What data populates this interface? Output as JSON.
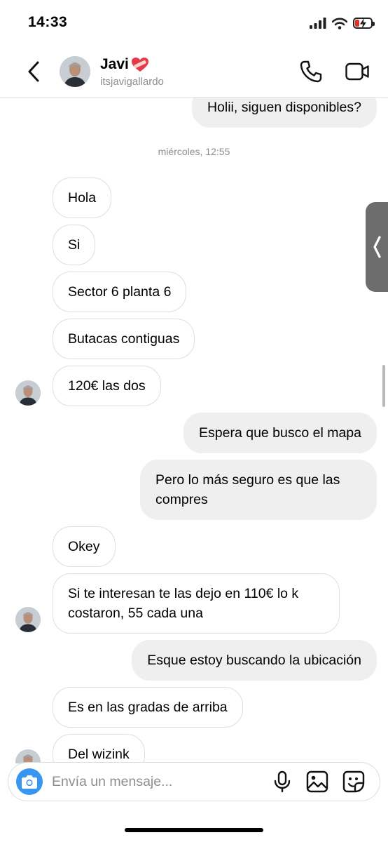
{
  "status_bar": {
    "time": "14:33",
    "battery_level": 0.25,
    "battery_color": "#e0302a"
  },
  "header": {
    "name": "Javi",
    "name_emoji": "heart-bandage-icon",
    "handle": "itsjavigallardo",
    "back_icon": "chevron-left-icon",
    "call_icon": "phone-icon",
    "video_icon": "video-camera-icon"
  },
  "messages": [
    {
      "from": "me",
      "text": "Holii, siguen disponibles?"
    },
    {
      "type": "timestamp",
      "text": "miércoles, 12:55"
    },
    {
      "from": "them",
      "text": "Hola"
    },
    {
      "from": "them",
      "text": "Si"
    },
    {
      "from": "them",
      "text": "Sector 6 planta 6"
    },
    {
      "from": "them",
      "text": "Butacas contiguas"
    },
    {
      "from": "them",
      "text": "120€ las dos"
    },
    {
      "from": "me",
      "text": "Espera que busco el mapa"
    },
    {
      "from": "me",
      "text": "Pero lo más seguro es que las compres"
    },
    {
      "from": "them",
      "text": "Okey"
    },
    {
      "from": "them",
      "text": "Si te interesan te las dejo en 110€ lo k costaron, 55 cada una"
    },
    {
      "from": "me",
      "text": "Esque estoy buscando la ubicación"
    },
    {
      "from": "them",
      "text": "Es en las gradas de arriba"
    },
    {
      "from": "them",
      "text": "Del wizink"
    }
  ],
  "composer": {
    "placeholder": "Envía un mensaje...",
    "camera_icon": "camera-icon",
    "mic_icon": "microphone-icon",
    "gallery_icon": "image-icon",
    "sticker_icon": "sticker-icon"
  },
  "colors": {
    "accent": "#3797f0",
    "outgoing_bubble": "#efefef",
    "incoming_border": "#dedede",
    "secondary_text": "#8e8e8e"
  }
}
